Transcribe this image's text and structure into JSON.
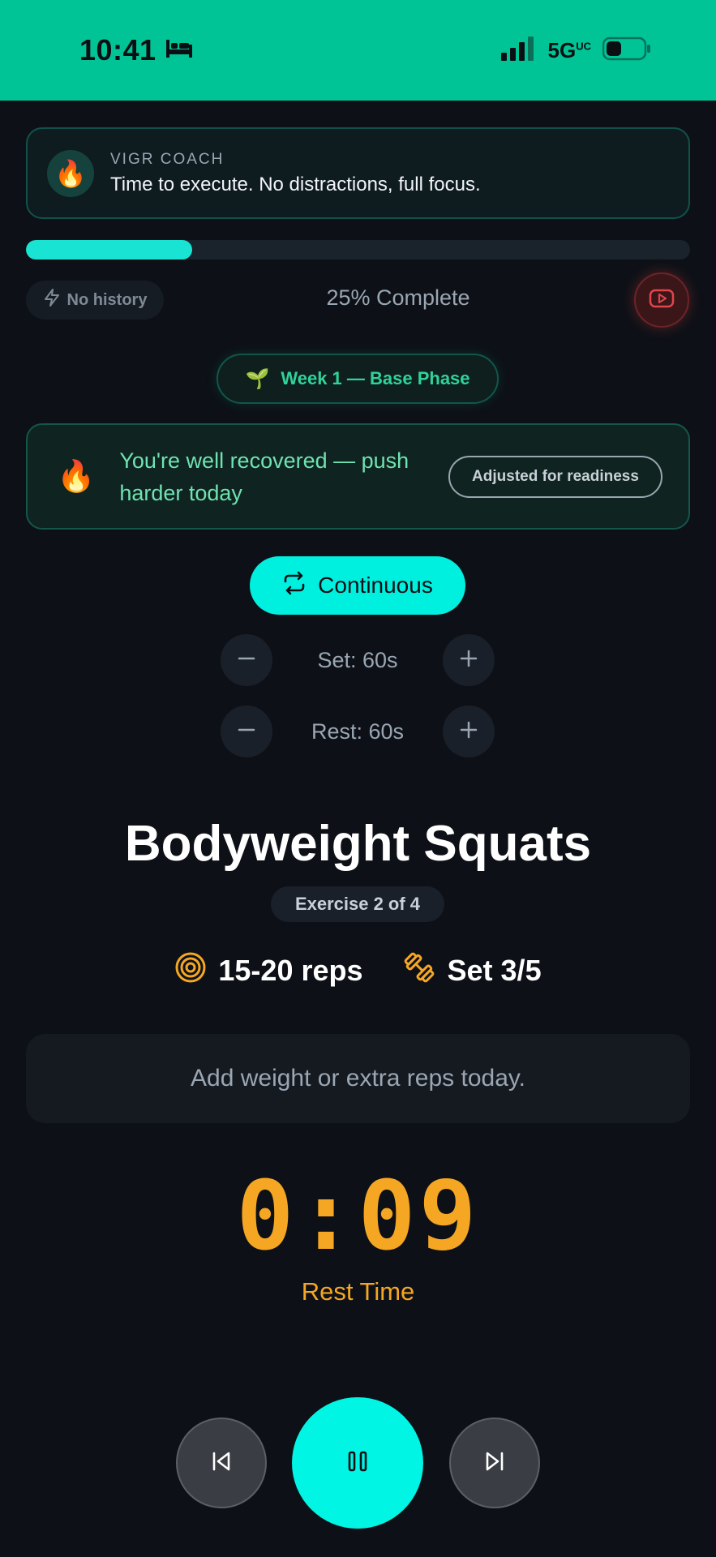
{
  "status_bar": {
    "time": "10:41",
    "network": "5G",
    "network_sup": "UC",
    "bg_color": "#00c496"
  },
  "coach": {
    "label": "VIGR COACH",
    "message": "Time to execute. No distractions, full focus.",
    "avatar_emoji": "🔥"
  },
  "progress": {
    "percent": 25,
    "complete_text": "25% Complete",
    "history_label": "No history"
  },
  "phase": {
    "emoji": "🌱",
    "label": "Week 1 — Base Phase"
  },
  "readiness": {
    "emoji": "🔥",
    "message": "You're well recovered — push harder today",
    "badge": "Adjusted for readiness"
  },
  "mode": {
    "label": "Continuous"
  },
  "set_stepper": {
    "label": "Set: 60s"
  },
  "rest_stepper": {
    "label": "Rest: 60s"
  },
  "exercise": {
    "name": "Bodyweight Squats",
    "position": "Exercise 2 of 4",
    "reps": "15-20 reps",
    "set": "Set 3/5",
    "tip": "Add weight or extra reps today."
  },
  "timer": {
    "value": "0:09",
    "label": "Rest Time",
    "color": "#f5a623"
  },
  "colors": {
    "accent": "#00f0e0",
    "green": "#2fd39a",
    "danger": "#e0454b"
  }
}
